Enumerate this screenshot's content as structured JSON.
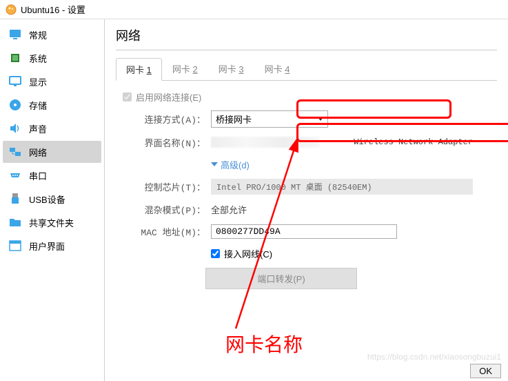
{
  "title": "Ubuntu16 - 设置",
  "sidebar": {
    "items": [
      {
        "label": "常规",
        "icon": "general"
      },
      {
        "label": "系统",
        "icon": "system"
      },
      {
        "label": "显示",
        "icon": "display"
      },
      {
        "label": "存储",
        "icon": "storage"
      },
      {
        "label": "声音",
        "icon": "audio"
      },
      {
        "label": "网络",
        "icon": "network"
      },
      {
        "label": "串口",
        "icon": "serial"
      },
      {
        "label": "USB设备",
        "icon": "usb"
      },
      {
        "label": "共享文件夹",
        "icon": "shared"
      },
      {
        "label": "用户界面",
        "icon": "ui"
      }
    ]
  },
  "page": {
    "title": "网络"
  },
  "tabs": [
    {
      "label": "网卡",
      "key": "1",
      "active": true
    },
    {
      "label": "网卡",
      "key": "2",
      "active": false
    },
    {
      "label": "网卡",
      "key": "3",
      "active": false
    },
    {
      "label": "网卡",
      "key": "4",
      "active": false
    }
  ],
  "form": {
    "enable_label": "启用网络连接(E)",
    "connection_label": "连接方式(A)：",
    "connection_value": "桥接网卡",
    "interface_label": "界面名称(N)：",
    "interface_value_suffix": "Wireless Network Adapter",
    "advanced_label": "高级(d)",
    "chip_label": "控制芯片(T)：",
    "chip_value": "Intel PRO/1000 MT 桌面 (82540EM)",
    "promisc_label": "混杂模式(P)：",
    "promisc_value": "全部允许",
    "mac_label": "MAC 地址(M)：",
    "mac_value": "0800277DD49A",
    "cable_label": "接入网线(C)",
    "port_forward_btn": "端口转发(P)"
  },
  "annotation": {
    "text": "网卡名称"
  },
  "watermark": "https://blog.csdn.net/xiaosongbuzui1",
  "ok_button": "OK"
}
